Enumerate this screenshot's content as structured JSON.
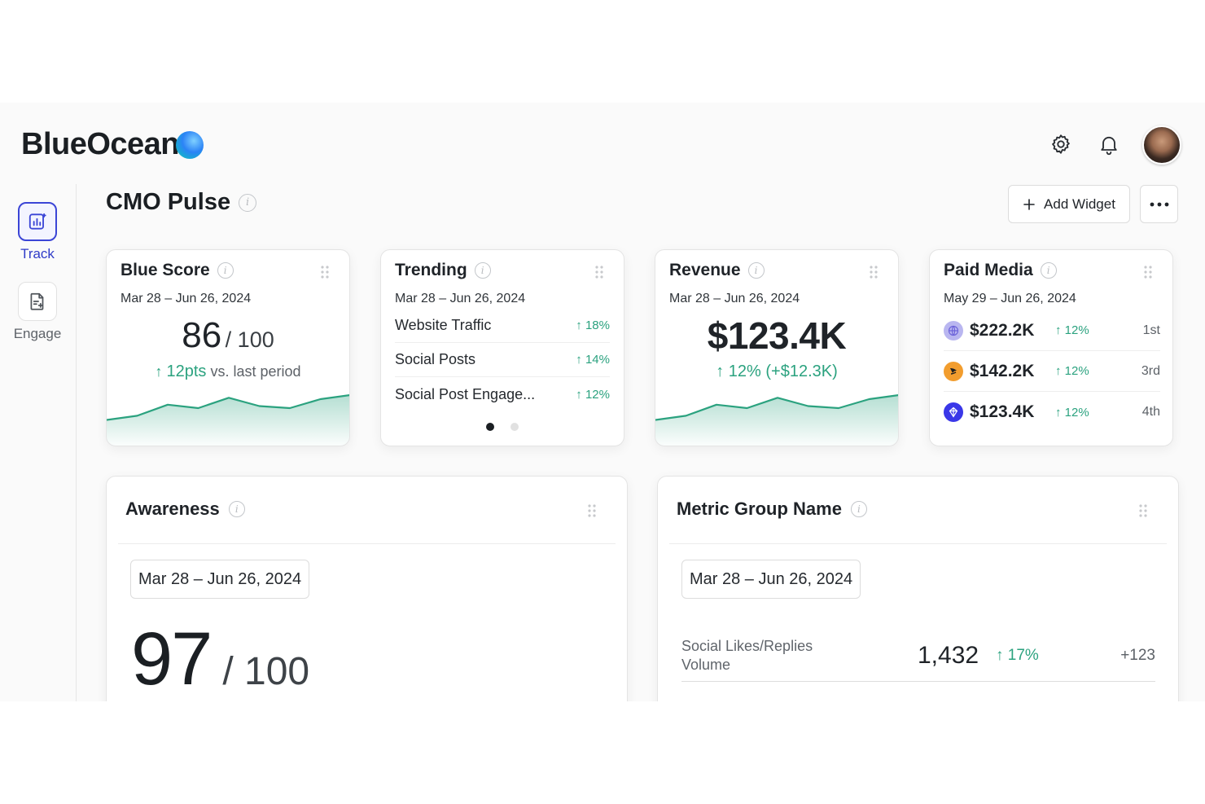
{
  "brand": {
    "name": "BlueOcean"
  },
  "header": {
    "icons": [
      "gear-icon",
      "bell-icon",
      "avatar"
    ]
  },
  "sidebar": {
    "items": [
      {
        "label": "Track",
        "icon": "chart-sparkle-icon",
        "active": true
      },
      {
        "label": "Engage",
        "icon": "document-edit-icon",
        "active": false
      }
    ]
  },
  "page": {
    "title": "CMO Pulse",
    "add_widget_label": "Add Widget"
  },
  "colors": {
    "accent": "#3b45d6",
    "positive": "#2ba27f"
  },
  "blue_score": {
    "title": "Blue Score",
    "date": "Mar 28 – Jun 26, 2024",
    "score": "86",
    "max": "/ 100",
    "delta": "12pts",
    "delta_suffix": "vs. last period",
    "spark": [
      30,
      36,
      52,
      47,
      62,
      50,
      47,
      60,
      66
    ]
  },
  "trending": {
    "title": "Trending",
    "date": "Mar 28 – Jun 26, 2024",
    "rows": [
      {
        "label": "Website Traffic",
        "pct": "18%"
      },
      {
        "label": "Social Posts",
        "pct": "14%"
      },
      {
        "label": "Social Post Engage...",
        "pct": "12%"
      }
    ],
    "page": 1,
    "pages": 2
  },
  "revenue": {
    "title": "Revenue",
    "date": "Mar 28 – Jun 26, 2024",
    "value": "$123.4K",
    "delta": "12% (+$12.3K)",
    "spark": [
      30,
      36,
      52,
      47,
      62,
      50,
      47,
      60,
      66
    ]
  },
  "paid_media": {
    "title": "Paid Media",
    "date": "May 29 – Jun 26, 2024",
    "rows": [
      {
        "value": "$222.2K",
        "pct": "12%",
        "rank": "1st",
        "icon": "purple-globe-icon"
      },
      {
        "value": "$142.2K",
        "pct": "12%",
        "rank": "3rd",
        "icon": "orange-brand-icon"
      },
      {
        "value": "$123.4K",
        "pct": "12%",
        "rank": "4th",
        "icon": "blue-brand-icon"
      }
    ]
  },
  "awareness": {
    "title": "Awareness",
    "date": "Mar 28 – Jun 26, 2024",
    "score": "97",
    "max": "/ 100"
  },
  "metric_group": {
    "title": "Metric Group Name",
    "date": "Mar 28 – Jun 26, 2024",
    "row": {
      "label": "Social Likes/Replies Volume",
      "value": "1,432",
      "pct": "17%",
      "abs": "+123"
    }
  }
}
